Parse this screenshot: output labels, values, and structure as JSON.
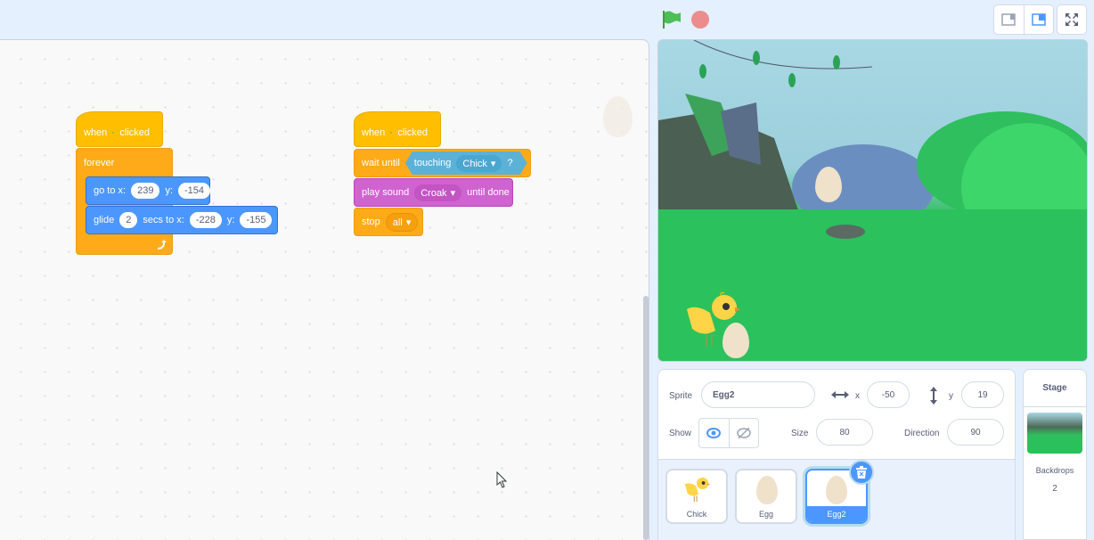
{
  "header": {
    "green_flag": "green-flag-icon",
    "stop": "stop-icon",
    "layout_small": "small-stage-layout-icon",
    "layout_normal": "normal-stage-layout-icon",
    "fullscreen": "fullscreen-icon"
  },
  "colors": {
    "events": "#ffbf00",
    "control": "#ffab19",
    "motion": "#4c97ff",
    "sound": "#cf63cf",
    "sensing": "#5cb1d6",
    "accent": "#4c97ff"
  },
  "scripts": [
    {
      "hat": {
        "when": "when",
        "clicked": "clicked"
      },
      "forever": "forever",
      "goto": {
        "label": "go to x:",
        "x": "239",
        "ylabel": "y:",
        "y": "-154"
      },
      "glide": {
        "label": "glide",
        "secs": "2",
        "mid": "secs to x:",
        "x": "-228",
        "ylabel": "y:",
        "y": "-155"
      }
    },
    {
      "hat": {
        "when": "when",
        "clicked": "clicked"
      },
      "wait": {
        "label": "wait until",
        "touching": "touching",
        "target": "Chick",
        "q": "?"
      },
      "play": {
        "label": "play sound",
        "sound": "Croak",
        "suffix": "until done"
      },
      "stop": {
        "label": "stop",
        "option": "all"
      }
    }
  ],
  "sprite_info": {
    "sprite_label": "Sprite",
    "sprite_name": "Egg2",
    "x_label": "x",
    "x": "-50",
    "y_label": "y",
    "y": "19",
    "show_label": "Show",
    "size_label": "Size",
    "size": "80",
    "direction_label": "Direction",
    "direction": "90"
  },
  "sprites": [
    {
      "name": "Chick",
      "selected": false
    },
    {
      "name": "Egg",
      "selected": false
    },
    {
      "name": "Egg2",
      "selected": true
    }
  ],
  "stage_panel": {
    "title": "Stage",
    "backdrops_label": "Backdrops",
    "backdrops_count": "2"
  }
}
